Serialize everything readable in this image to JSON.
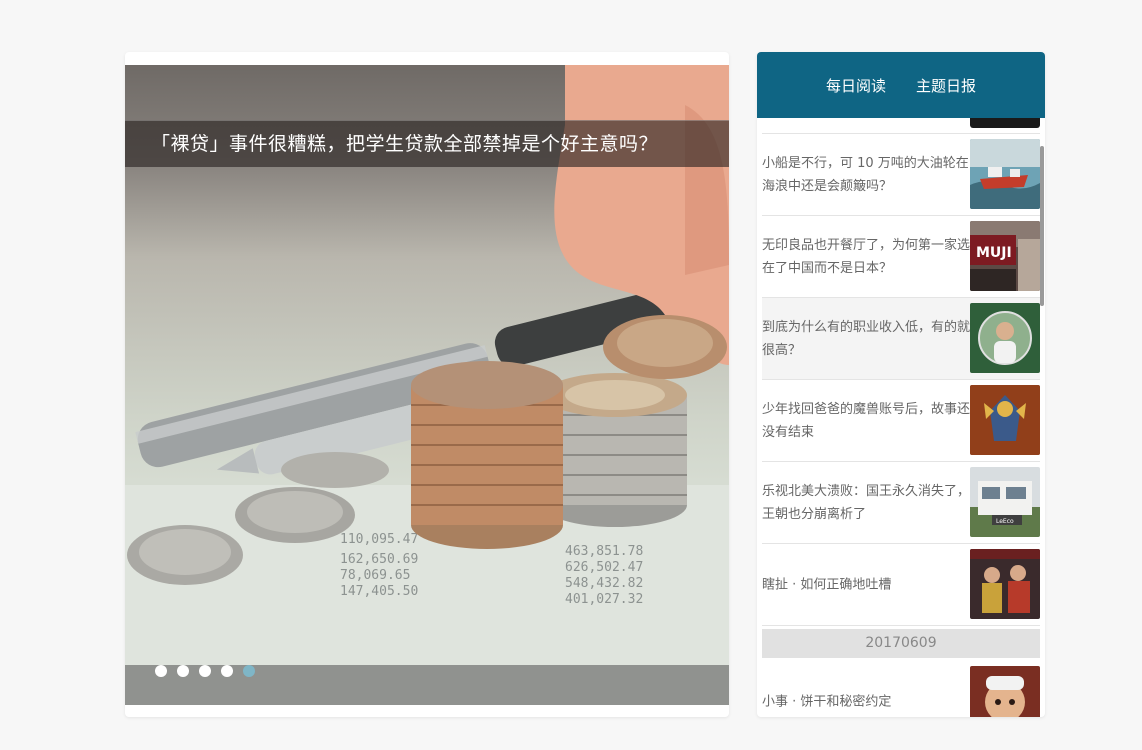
{
  "carousel": {
    "caption": "「裸贷」事件很糟糕，把学生贷款全部禁掉是个好主意吗？",
    "dots": [
      {
        "active": false
      },
      {
        "active": false
      },
      {
        "active": false
      },
      {
        "active": false
      },
      {
        "active": true
      }
    ],
    "thumbnail_subject": "coins-and-pen"
  },
  "sidebar": {
    "tabs": [
      "每日阅读",
      "主题日报"
    ],
    "items": [
      {
        "title": "小船是不行，可 10 万吨的大油轮在海浪中还是会颠簸吗？",
        "thumb": "ship-thumbnail"
      },
      {
        "title": "无印良品也开餐厅了，为何第一家选在了中国而不是日本？",
        "thumb": "muji-store-thumbnail"
      },
      {
        "title": "到底为什么有的职业收入低，有的就很高？",
        "thumb": "person-portrait-thumbnail"
      },
      {
        "title": "少年找回爸爸的魔兽账号后，故事还没有结束",
        "thumb": "warcraft-character-thumbnail"
      },
      {
        "title": "乐视北美大溃败：国王永久消失了，王朝也分崩离析了",
        "thumb": "leeco-building-thumbnail"
      },
      {
        "title": "瞎扯 · 如何正确地吐槽",
        "thumb": "performers-thumbnail"
      }
    ],
    "date_label": "20170609",
    "after_date_items": [
      {
        "title": "小事 · 饼干和秘密约定",
        "thumb": "animated-character-thumbnail"
      }
    ]
  },
  "colors": {
    "header_bg": "#0f6584",
    "active_dot": "#7fb6c7",
    "page_bg": "#f7f7f7"
  }
}
